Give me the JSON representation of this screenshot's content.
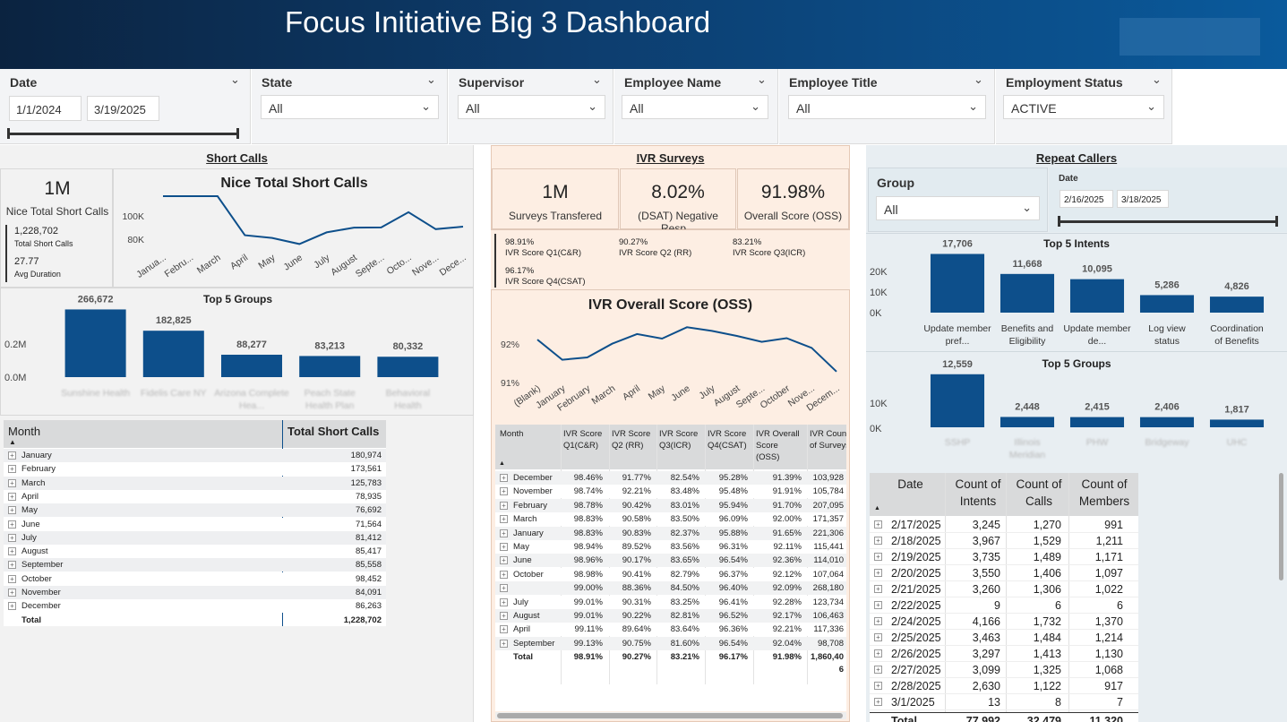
{
  "app": {
    "title": "Focus Initiative Big 3 Dashboard"
  },
  "filters": {
    "date": {
      "label": "Date",
      "start": "1/1/2024",
      "end": "3/19/2025"
    },
    "state": {
      "label": "State",
      "value": "All"
    },
    "supervisor": {
      "label": "Supervisor",
      "value": "All"
    },
    "employee_name": {
      "label": "Employee Name",
      "value": "All"
    },
    "employee_title": {
      "label": "Employee Title",
      "value": "All"
    },
    "employment_status": {
      "label": "Employment Status",
      "value": "ACTIVE"
    }
  },
  "short_calls": {
    "section_title": "Short Calls",
    "kpi_value": "1M",
    "kpi_label": "Nice Total Short Calls",
    "total_value": "1,228,702",
    "total_label": "Total Short Calls",
    "avg_value": "27.77",
    "avg_label": "Avg Duration",
    "table": {
      "headers": [
        "Month",
        "Total Short Calls"
      ],
      "rows": [
        [
          "January",
          "180,974"
        ],
        [
          "February",
          "173,561"
        ],
        [
          "March",
          "125,783"
        ],
        [
          "April",
          "78,935"
        ],
        [
          "May",
          "76,692"
        ],
        [
          "June",
          "71,564"
        ],
        [
          "July",
          "81,412"
        ],
        [
          "August",
          "85,417"
        ],
        [
          "September",
          "85,558"
        ],
        [
          "October",
          "98,452"
        ],
        [
          "November",
          "84,091"
        ],
        [
          "December",
          "86,263"
        ]
      ],
      "total": [
        "Total",
        "1,228,702"
      ]
    }
  },
  "ivr": {
    "section_title": "IVR Surveys",
    "kpis": [
      {
        "value": "1M",
        "label": "Surveys Transfered"
      },
      {
        "value": "8.02%",
        "label": "(DSAT) Negative Resp..."
      },
      {
        "value": "91.98%",
        "label": "Overall Score (OSS)"
      }
    ],
    "scores": [
      {
        "value": "98.91%",
        "label": "IVR Score Q1(C&R)"
      },
      {
        "value": "90.27%",
        "label": "IVR Score Q2 (RR)"
      },
      {
        "value": "83.21%",
        "label": "IVR Score Q3(ICR)"
      },
      {
        "value": "96.17%",
        "label": "IVR Score Q4(CSAT)"
      }
    ],
    "table": {
      "headers": [
        "Month",
        "IVR Score Q1(C&R)",
        "IVR Score Q2 (RR)",
        "IVR Score Q3(ICR)",
        "IVR Score Q4(CSAT)",
        "IVR Overall Score (OSS)",
        "IVR Count of Surveys"
      ],
      "rows": [
        [
          "December",
          "98.46%",
          "91.77%",
          "82.54%",
          "95.28%",
          "91.39%",
          "103,928"
        ],
        [
          "November",
          "98.74%",
          "92.21%",
          "83.48%",
          "95.48%",
          "91.91%",
          "105,784"
        ],
        [
          "February",
          "98.78%",
          "90.42%",
          "83.01%",
          "95.94%",
          "91.70%",
          "207,095"
        ],
        [
          "March",
          "98.83%",
          "90.58%",
          "83.50%",
          "96.09%",
          "92.00%",
          "171,357"
        ],
        [
          "January",
          "98.83%",
          "90.83%",
          "82.37%",
          "95.88%",
          "91.65%",
          "221,306"
        ],
        [
          "May",
          "98.94%",
          "89.52%",
          "83.56%",
          "96.31%",
          "92.11%",
          "115,441"
        ],
        [
          "June",
          "98.96%",
          "90.17%",
          "83.65%",
          "96.54%",
          "92.36%",
          "114,010"
        ],
        [
          "October",
          "98.98%",
          "90.41%",
          "82.79%",
          "96.37%",
          "92.12%",
          "107,064"
        ],
        [
          "",
          "99.00%",
          "88.36%",
          "84.50%",
          "96.40%",
          "92.09%",
          "268,180"
        ],
        [
          "July",
          "99.01%",
          "90.31%",
          "83.25%",
          "96.41%",
          "92.28%",
          "123,734"
        ],
        [
          "August",
          "99.01%",
          "90.22%",
          "82.81%",
          "96.52%",
          "92.17%",
          "106,463"
        ],
        [
          "April",
          "99.11%",
          "89.64%",
          "83.64%",
          "96.36%",
          "92.21%",
          "117,336"
        ],
        [
          "September",
          "99.13%",
          "90.75%",
          "81.60%",
          "96.54%",
          "92.04%",
          "98,708"
        ]
      ],
      "total": [
        "Total",
        "98.91%",
        "90.27%",
        "83.21%",
        "96.17%",
        "91.98%",
        "1,860,40",
        "6"
      ]
    }
  },
  "repeat": {
    "section_title": "Repeat Callers",
    "group_filter": {
      "label": "Group",
      "value": "All"
    },
    "date_filter": {
      "label": "Date",
      "start": "2/16/2025",
      "end": "3/18/2025"
    },
    "table": {
      "headers": [
        "Date",
        "Count of Intents",
        "Count of Calls",
        "Count of Members"
      ],
      "rows": [
        [
          "2/17/2025",
          "3,245",
          "1,270",
          "991"
        ],
        [
          "2/18/2025",
          "3,967",
          "1,529",
          "1,211"
        ],
        [
          "2/19/2025",
          "3,735",
          "1,489",
          "1,171"
        ],
        [
          "2/20/2025",
          "3,550",
          "1,406",
          "1,097"
        ],
        [
          "2/21/2025",
          "3,260",
          "1,306",
          "1,022"
        ],
        [
          "2/22/2025",
          "9",
          "6",
          "6"
        ],
        [
          "2/24/2025",
          "4,166",
          "1,732",
          "1,370"
        ],
        [
          "2/25/2025",
          "3,463",
          "1,484",
          "1,214"
        ],
        [
          "2/26/2025",
          "3,297",
          "1,413",
          "1,130"
        ],
        [
          "2/27/2025",
          "3,099",
          "1,325",
          "1,068"
        ],
        [
          "2/28/2025",
          "2,630",
          "1,122",
          "917"
        ],
        [
          "3/1/2025",
          "13",
          "8",
          "7"
        ]
      ],
      "total": [
        "Total",
        "77,992",
        "32,479",
        "11,320"
      ]
    }
  },
  "chart_data": [
    {
      "type": "line",
      "title": "Nice Total Short Calls",
      "categories": [
        "January",
        "February",
        "March",
        "April",
        "May",
        "June",
        "July",
        "August",
        "September",
        "October",
        "November",
        "December"
      ],
      "tick_labels": [
        "Janua...",
        "Febru...",
        "March",
        "April",
        "May",
        "June",
        "July",
        "August",
        "Septe...",
        "Octo...",
        "Nove...",
        "Dece..."
      ],
      "values": [
        180974,
        173561,
        125783,
        78935,
        76692,
        71564,
        81412,
        85417,
        85558,
        98452,
        84091,
        86263
      ],
      "yticks": [
        "100K",
        "80K"
      ],
      "ylim": [
        62000,
        112000
      ],
      "color": "#0d4f8b"
    },
    {
      "type": "bar",
      "title": "Top 5 Groups",
      "categories": [
        "Sunshine Health",
        "Fidelis Care NY",
        "Arizona Complete Hea...",
        "Peach State Health Plan",
        "Behavioral Health"
      ],
      "values": [
        266672,
        182825,
        88277,
        83213,
        80332
      ],
      "labels": [
        "266,672",
        "182,825",
        "88,277",
        "83,213",
        "80,332"
      ],
      "yticks": [
        "0.2M",
        "0.0M"
      ],
      "ylim": [
        0,
        300000
      ],
      "color": "#0d4f8b"
    },
    {
      "type": "line",
      "title": "IVR Overall Score (OSS)",
      "categories": [
        "(Blank)",
        "January",
        "February",
        "March",
        "April",
        "May",
        "June",
        "July",
        "August",
        "September",
        "October",
        "November",
        "December"
      ],
      "tick_labels": [
        "(Blank)",
        "January",
        "February",
        "March",
        "April",
        "May",
        "June",
        "July",
        "August",
        "Septe...",
        "October",
        "Nove...",
        "Decem..."
      ],
      "values": [
        92.09,
        91.65,
        91.7,
        92.0,
        92.21,
        92.11,
        92.36,
        92.28,
        92.17,
        92.04,
        92.12,
        91.91,
        91.39
      ],
      "yticks": [
        "92%",
        "91%"
      ],
      "ylim": [
        90.8,
        92.6
      ],
      "color": "#0d4f8b"
    },
    {
      "type": "bar",
      "title": "Top 5 Intents",
      "categories": [
        "Update member pref...",
        "Benefits and Eligibility for ...",
        "Update member de...",
        "Log view status",
        "Coordination of Benefits"
      ],
      "values": [
        17706,
        11668,
        10095,
        5286,
        4826
      ],
      "labels": [
        "17,706",
        "11,668",
        "10,095",
        "5,286",
        "4,826"
      ],
      "yticks": [
        "20K",
        "10K",
        "0K"
      ],
      "ylim": [
        0,
        20000
      ],
      "color": "#0d4f8b"
    },
    {
      "type": "bar",
      "title": "Top 5 Groups",
      "categories": [
        "SSHP",
        "Illinois Meridian",
        "PHW",
        "Bridgeway",
        "UHC"
      ],
      "values": [
        12559,
        2448,
        2415,
        2406,
        1817
      ],
      "labels": [
        "12,559",
        "2,448",
        "2,415",
        "2,406",
        "1,817"
      ],
      "yticks": [
        "10K",
        "0K"
      ],
      "ylim": [
        0,
        14000
      ],
      "color": "#0d4f8b"
    }
  ]
}
